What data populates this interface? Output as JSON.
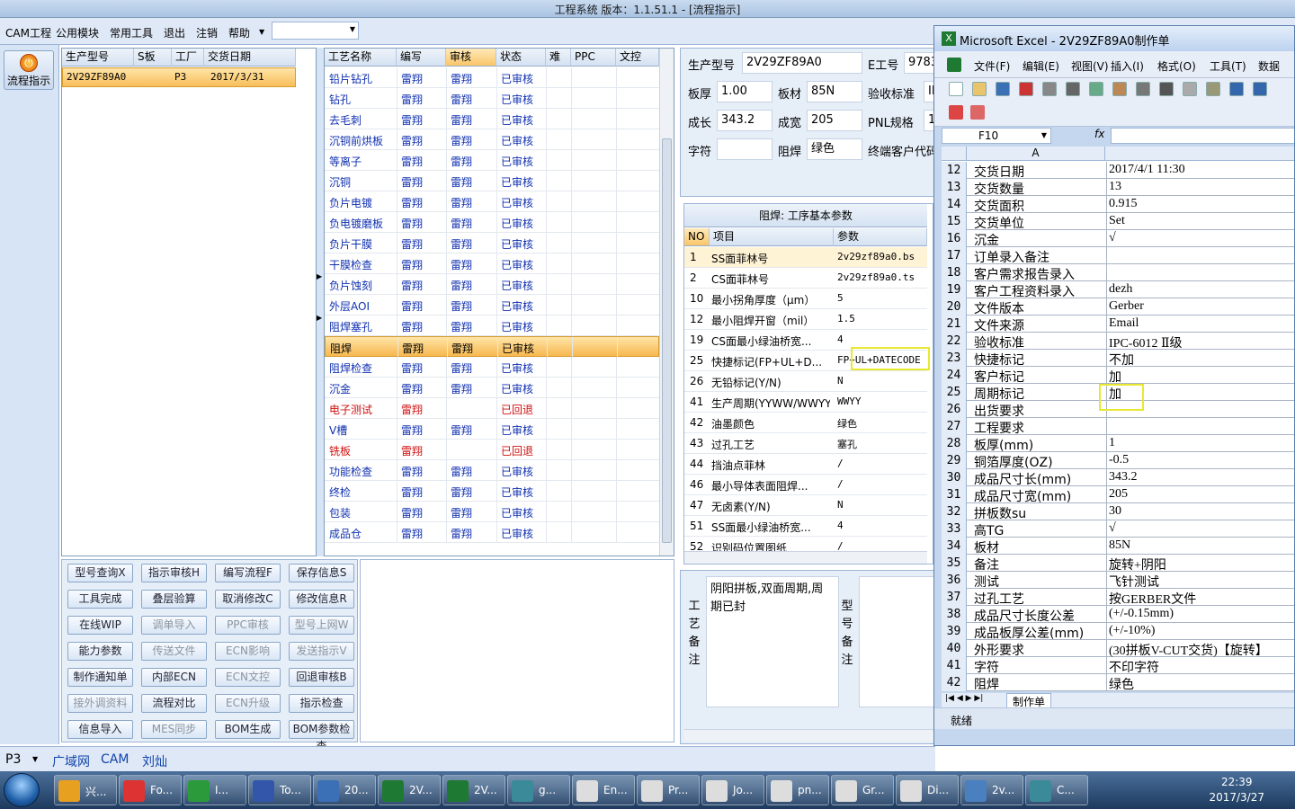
{
  "app": {
    "title": "工程系统 版本：1.1.51.1 - [流程指示]"
  },
  "menu": [
    "CAM工程",
    "公用模块",
    "常用工具",
    "退出",
    "注销",
    "帮助"
  ],
  "left": {
    "flow_label": "流程指示"
  },
  "model_table": {
    "headers": [
      "生产型号",
      "S板",
      "工厂",
      "交货日期"
    ],
    "rows": [
      [
        "2V29ZF89A0",
        "",
        "P3",
        "2017/3/31"
      ]
    ]
  },
  "process": {
    "headers": [
      "工艺名称",
      "编写",
      "审核",
      "状态",
      "难",
      "PPC",
      "文控"
    ],
    "rows": [
      {
        "name": "铅片钻孔",
        "writer": "雷翔",
        "reviewer": "雷翔",
        "status": "已审核",
        "red": false
      },
      {
        "name": "钻孔",
        "writer": "雷翔",
        "reviewer": "雷翔",
        "status": "已审核",
        "red": false
      },
      {
        "name": "去毛刺",
        "writer": "雷翔",
        "reviewer": "雷翔",
        "status": "已审核",
        "red": false
      },
      {
        "name": "沉铜前烘板",
        "writer": "雷翔",
        "reviewer": "雷翔",
        "status": "已审核",
        "red": false
      },
      {
        "name": "等离子",
        "writer": "雷翔",
        "reviewer": "雷翔",
        "status": "已审核",
        "red": false
      },
      {
        "name": "沉铜",
        "writer": "雷翔",
        "reviewer": "雷翔",
        "status": "已审核",
        "red": false
      },
      {
        "name": "负片电镀",
        "writer": "雷翔",
        "reviewer": "雷翔",
        "status": "已审核",
        "red": false
      },
      {
        "name": "负电镀磨板",
        "writer": "雷翔",
        "reviewer": "雷翔",
        "status": "已审核",
        "red": false
      },
      {
        "name": "负片干膜",
        "writer": "雷翔",
        "reviewer": "雷翔",
        "status": "已审核",
        "red": false
      },
      {
        "name": "干膜检查",
        "writer": "雷翔",
        "reviewer": "雷翔",
        "status": "已审核",
        "red": false
      },
      {
        "name": "负片蚀刻",
        "writer": "雷翔",
        "reviewer": "雷翔",
        "status": "已审核",
        "red": false
      },
      {
        "name": "外层AOI",
        "writer": "雷翔",
        "reviewer": "雷翔",
        "status": "已审核",
        "red": false
      },
      {
        "name": "阻焊塞孔",
        "writer": "雷翔",
        "reviewer": "雷翔",
        "status": "已审核",
        "red": false
      },
      {
        "name": "阻焊",
        "writer": "雷翔",
        "reviewer": "雷翔",
        "status": "已审核",
        "red": false,
        "selected": true
      },
      {
        "name": "阻焊检查",
        "writer": "雷翔",
        "reviewer": "雷翔",
        "status": "已审核",
        "red": false
      },
      {
        "name": "沉金",
        "writer": "雷翔",
        "reviewer": "雷翔",
        "status": "已审核",
        "red": false
      },
      {
        "name": "电子测试",
        "writer": "雷翔",
        "reviewer": "",
        "status": "已回退",
        "red": true
      },
      {
        "name": "V槽",
        "writer": "雷翔",
        "reviewer": "雷翔",
        "status": "已审核",
        "red": false
      },
      {
        "name": "铣板",
        "writer": "雷翔",
        "reviewer": "",
        "status": "已回退",
        "red": true
      },
      {
        "name": "功能检查",
        "writer": "雷翔",
        "reviewer": "雷翔",
        "status": "已审核",
        "red": false
      },
      {
        "name": "终检",
        "writer": "雷翔",
        "reviewer": "雷翔",
        "status": "已审核",
        "red": false
      },
      {
        "name": "包装",
        "writer": "雷翔",
        "reviewer": "雷翔",
        "status": "已审核",
        "red": false
      },
      {
        "name": "成品仓",
        "writer": "雷翔",
        "reviewer": "雷翔",
        "status": "已审核",
        "red": false
      }
    ]
  },
  "buttons": [
    [
      {
        "t": "型号查询X",
        "d": false
      },
      {
        "t": "指示审核H",
        "d": false
      },
      {
        "t": "编写流程F",
        "d": false
      },
      {
        "t": "保存信息S",
        "d": false
      }
    ],
    [
      {
        "t": "工具完成",
        "d": false
      },
      {
        "t": "叠层验算",
        "d": false
      },
      {
        "t": "取消修改C",
        "d": false
      },
      {
        "t": "修改信息R",
        "d": false
      }
    ],
    [
      {
        "t": "在线WIP",
        "d": false
      },
      {
        "t": "调单导入",
        "d": true
      },
      {
        "t": "PPC审核",
        "d": true
      },
      {
        "t": "型号上网W",
        "d": true
      }
    ],
    [
      {
        "t": "能力参数",
        "d": false
      },
      {
        "t": "传送文件",
        "d": true
      },
      {
        "t": "ECN影响",
        "d": true
      },
      {
        "t": "发送指示V",
        "d": true
      }
    ],
    [
      {
        "t": "制作通知单",
        "d": false
      },
      {
        "t": "内部ECN",
        "d": false
      },
      {
        "t": "ECN文控",
        "d": true
      },
      {
        "t": "回退审核B",
        "d": false
      }
    ],
    [
      {
        "t": "接外调资料",
        "d": true
      },
      {
        "t": "流程对比",
        "d": false
      },
      {
        "t": "ECN升级",
        "d": true
      },
      {
        "t": "指示检查",
        "d": false
      }
    ],
    [
      {
        "t": "信息导入",
        "d": false
      },
      {
        "t": "MES同步",
        "d": true
      },
      {
        "t": "BOM生成",
        "d": false
      },
      {
        "t": "BOM参数检查",
        "d": false
      }
    ]
  ],
  "info": {
    "model_label": "生产型号",
    "model_value": "2V29ZF89A0",
    "eno_label": "E工号",
    "eno_value": "9783",
    "thick_label": "板厚",
    "thick_value": "1.00",
    "material_label": "板材",
    "material_value": "85N",
    "accept_label": "验收标准",
    "accept_value": "IP",
    "len_label": "成长",
    "len_value": "343.2",
    "width_label": "成宽",
    "width_value": "205",
    "pnl_label": "PNL规格",
    "pnl_value": "1",
    "char_label": "字符",
    "char_value": "",
    "solder_label": "阻焊",
    "solder_value": "绿色",
    "end_label": "终端客户代码"
  },
  "params": {
    "caption": "阻焊: 工序基本参数",
    "headers": [
      "NO",
      "项目",
      "参数"
    ],
    "rows": [
      [
        "1",
        "SS面菲林号",
        "2v29zf89a0.bs"
      ],
      [
        "2",
        "CS面菲林号",
        "2v29zf89a0.ts"
      ],
      [
        "10",
        "最小拐角厚度（μm）",
        "5"
      ],
      [
        "12",
        "最小阻焊开窗（mil）",
        "1.5"
      ],
      [
        "19",
        "CS面最小绿油桥宽...",
        "4"
      ],
      [
        "25",
        "快捷标记(FP+UL+D...",
        "FP+UL+DATECODE"
      ],
      [
        "26",
        "无铅标记(Y/N)",
        "N"
      ],
      [
        "41",
        "生产周期(YYWW/WWYY)",
        "WWYY"
      ],
      [
        "42",
        "油墨颜色",
        "绿色"
      ],
      [
        "43",
        "过孔工艺",
        "塞孔"
      ],
      [
        "44",
        "挡油点菲林",
        "/"
      ],
      [
        "46",
        "最小导体表面阻焊...",
        "/"
      ],
      [
        "47",
        "无卤素(Y/N)",
        "N"
      ],
      [
        "51",
        "SS面最小绿油桥宽...",
        "4"
      ],
      [
        "52",
        "识别码位置图纸",
        "/"
      ]
    ]
  },
  "notes": {
    "process_label": "工艺备注",
    "process_text": "阴阳拼板,双面周期,周期已封",
    "model_label": "型号备注"
  },
  "status": {
    "plant": "P3",
    "network": "广域网",
    "dept": "CAM",
    "user": "刘灿"
  },
  "excel": {
    "title": "Microsoft Excel - 2V29ZF89A0制作单",
    "menu": [
      "文件(F)",
      "编辑(E)",
      "视图(V)",
      "插入(I)",
      "格式(O)",
      "工具(T)",
      "数据"
    ],
    "cell_ref": "F10",
    "col": "A",
    "sheet_tab": "制作单",
    "status": "就绪",
    "rows": [
      [
        "12",
        "交货日期",
        "2017/4/1 11:30"
      ],
      [
        "13",
        "交货数量",
        "13"
      ],
      [
        "14",
        "交货面积",
        "0.915"
      ],
      [
        "15",
        "交货单位",
        "Set"
      ],
      [
        "16",
        "沉金",
        "√"
      ],
      [
        "17",
        "订单录入备注",
        ""
      ],
      [
        "18",
        "客户需求报告录入",
        ""
      ],
      [
        "19",
        "客户工程资料录入",
        "dezh"
      ],
      [
        "20",
        "文件版本",
        "Gerber"
      ],
      [
        "21",
        "文件来源",
        "Email"
      ],
      [
        "22",
        "验收标准",
        "IPC-6012 Ⅱ级"
      ],
      [
        "23",
        "快捷标记",
        "不加"
      ],
      [
        "24",
        "客户标记",
        "加"
      ],
      [
        "25",
        "周期标记",
        "加"
      ],
      [
        "26",
        "出货要求",
        ""
      ],
      [
        "27",
        "工程要求",
        ""
      ],
      [
        "28",
        "板厚(mm)",
        "1"
      ],
      [
        "29",
        "铜箔厚度(OZ)",
        "-0.5"
      ],
      [
        "30",
        "成品尺寸长(mm)",
        "343.2"
      ],
      [
        "31",
        "成品尺寸宽(mm)",
        "205"
      ],
      [
        "32",
        "拼板数su",
        "30"
      ],
      [
        "33",
        "高TG",
        "√"
      ],
      [
        "34",
        "板材",
        "85N"
      ],
      [
        "35",
        "备注",
        "旋转+阴阳"
      ],
      [
        "36",
        "测试",
        "飞针测试"
      ],
      [
        "37",
        "过孔工艺",
        "按GERBER文件"
      ],
      [
        "38",
        "成品尺寸长度公差",
        "(+/-0.15mm)"
      ],
      [
        "39",
        "成品板厚公差(mm)",
        "(+/-10%)"
      ],
      [
        "40",
        "外形要求",
        "(30拼板V-CUT交货)【旋转】"
      ],
      [
        "41",
        "字符",
        "不印字符"
      ],
      [
        "42",
        "阻焊",
        "绿色"
      ]
    ]
  },
  "taskbar": {
    "tasks": [
      "兴...",
      "Fo...",
      "I...",
      "To...",
      "20...",
      "2V...",
      "2V...",
      "g...",
      "En...",
      "Pr...",
      "Jo...",
      "pn...",
      "Gr...",
      "Di...",
      "2v...",
      "C..."
    ],
    "time": "22:39",
    "date": "2017/3/27"
  }
}
